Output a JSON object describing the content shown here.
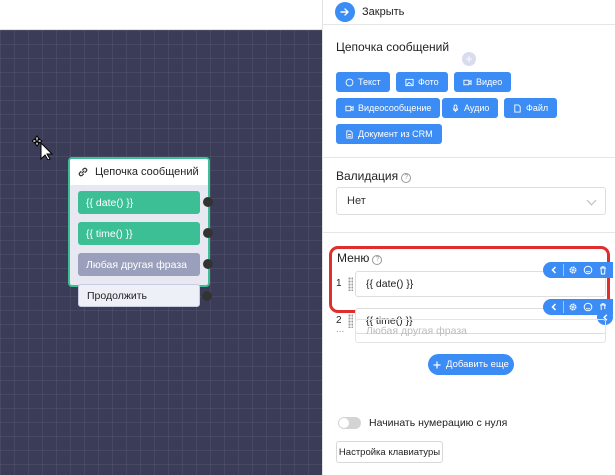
{
  "node": {
    "title": "Цепочка сообщений",
    "items": [
      {
        "label": "{{ date() }}"
      },
      {
        "label": "{{ time() }}"
      },
      {
        "label": "Любая другая фраза"
      },
      {
        "label": "Продолжить"
      }
    ]
  },
  "panel": {
    "close_label": "Закрыть",
    "chain_title": "Цепочка сообщений",
    "chips": [
      "Текст",
      "Фото",
      "Видео",
      "Видеосообщение",
      "Аудио",
      "Файл",
      "Документ из CRM"
    ],
    "validation": {
      "title": "Валидация",
      "help": "?",
      "value": "Нет"
    },
    "menu": {
      "title": "Меню",
      "help": "?",
      "rows": [
        {
          "num": "1",
          "value": "{{ date() }}"
        },
        {
          "num": "2",
          "value": "{{ time() }}"
        }
      ],
      "any": {
        "num": "...",
        "placeholder": "Любая другая фраза"
      }
    },
    "add_more_label": "Добавить еще",
    "numbering_toggle_label": "Начинать нумерацию с нуля",
    "numbering_toggle_on": false,
    "keyboard_btn_label": "Настройка клавиатуры"
  },
  "colors": {
    "accent": "#3b8cf5",
    "green": "#3dbf96",
    "highlight": "#e02d2d",
    "canvas": "#3b3d58"
  }
}
